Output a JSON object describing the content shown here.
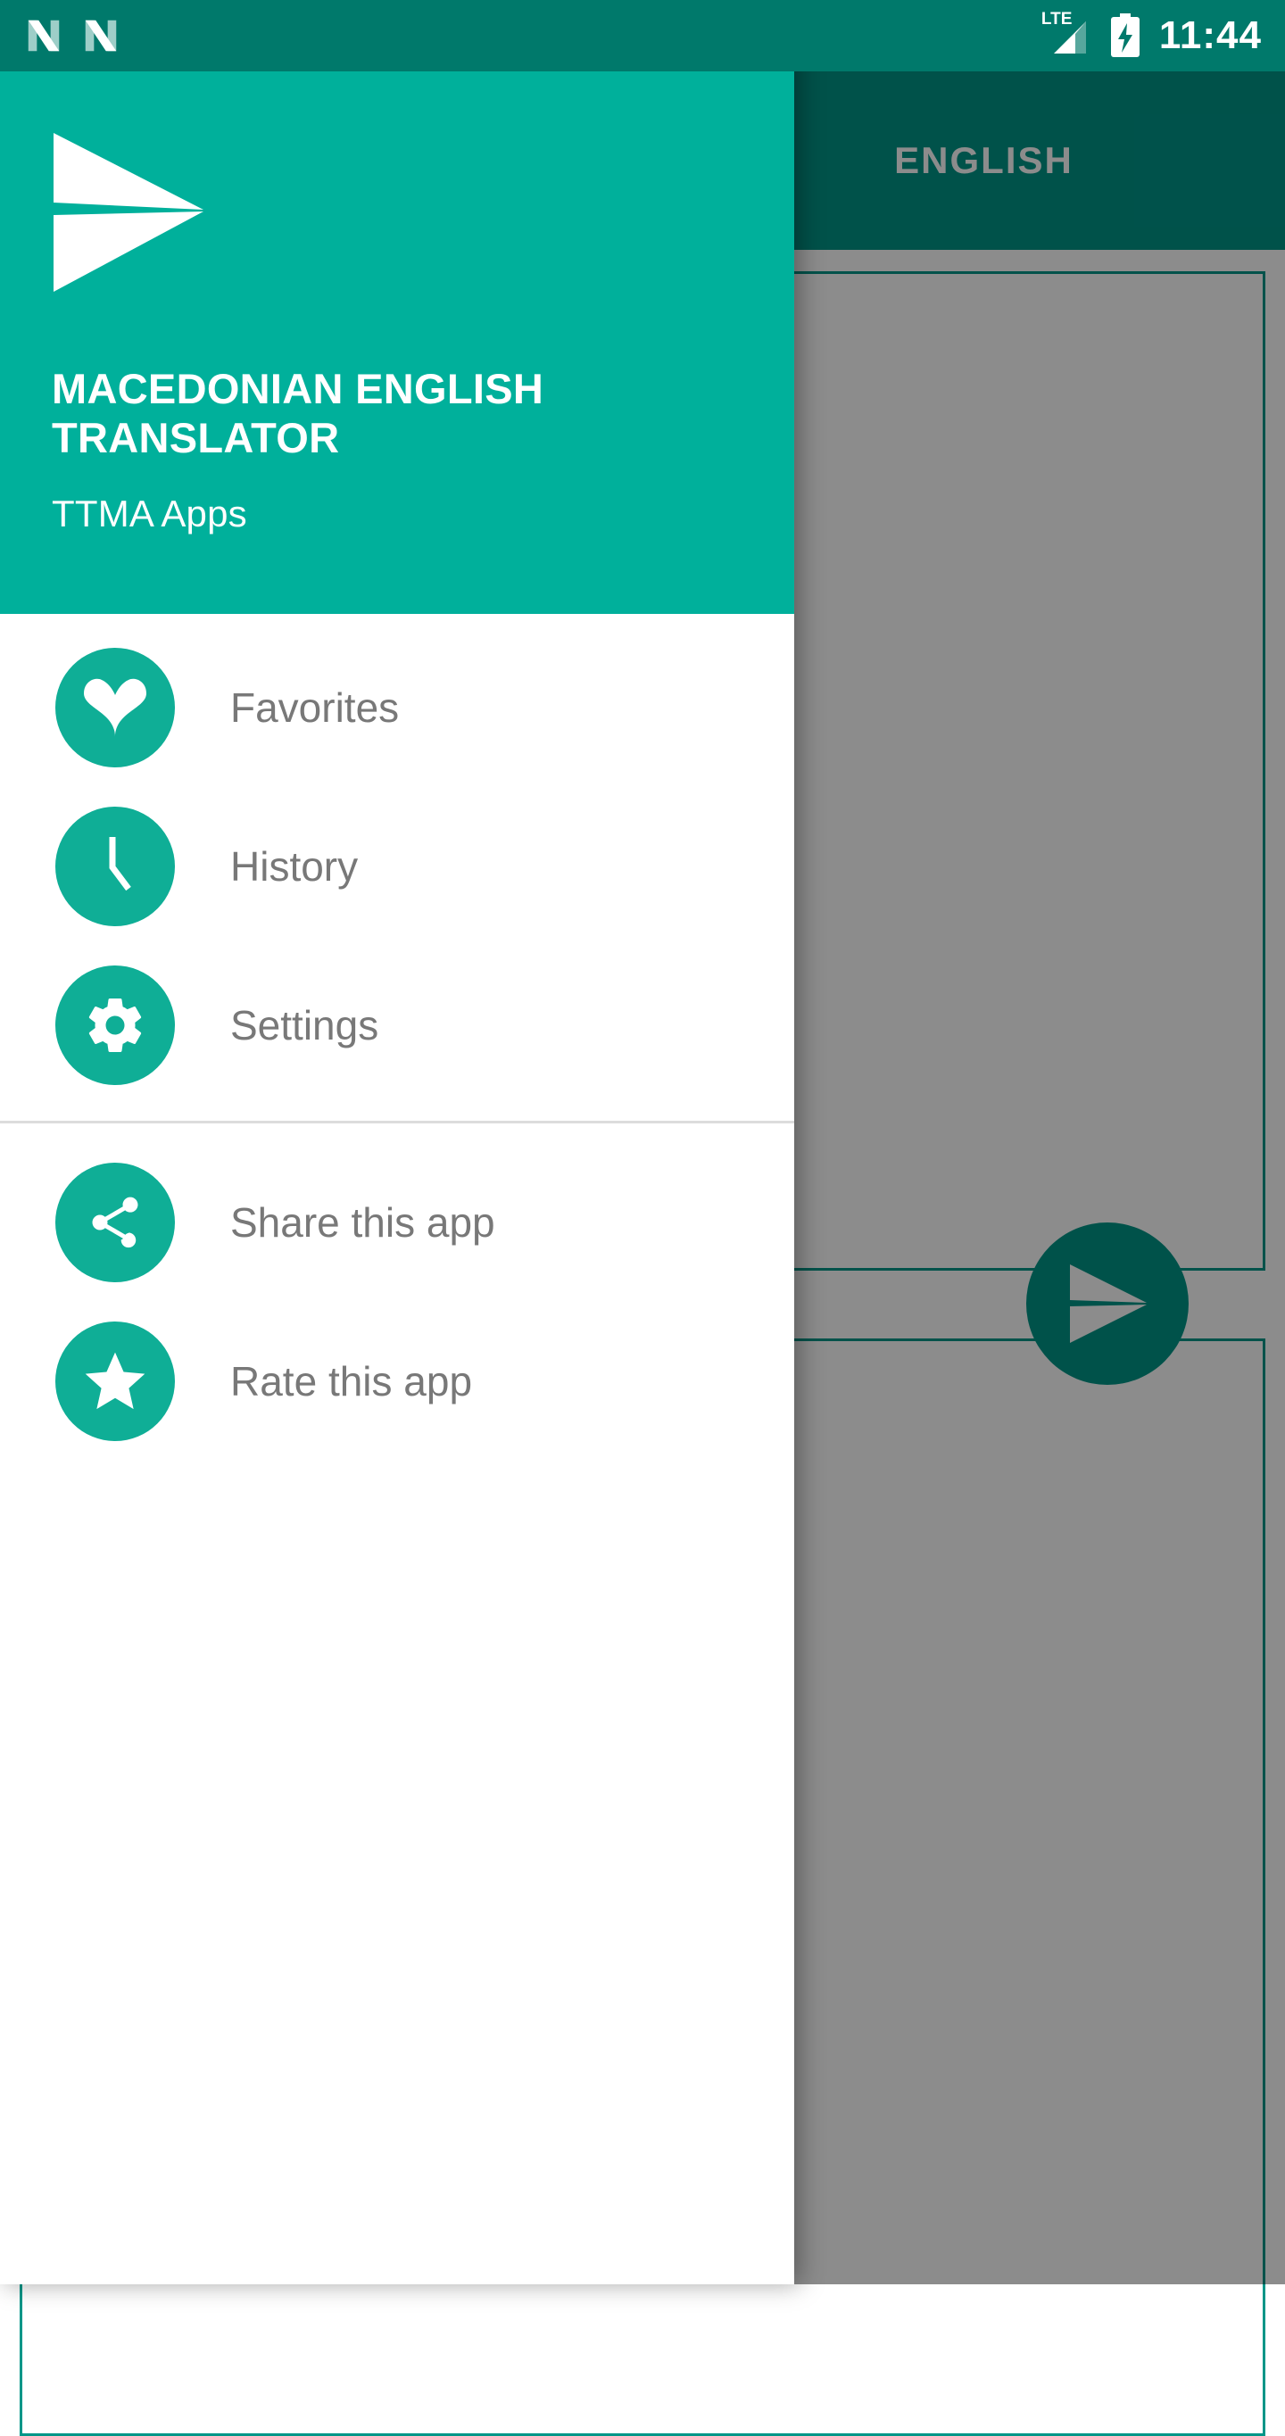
{
  "status_bar": {
    "notification_icons": [
      "android-nougat-icon",
      "android-nougat-icon"
    ],
    "network_label": "LTE",
    "signal_icon": "signal-bars-icon",
    "battery_icon": "battery-charging-icon",
    "clock": "11:44",
    "background_color": "#00796B"
  },
  "app": {
    "toolbar": {
      "source_caret_icon": "chevron-down-icon",
      "target_language_tab": "ENGLISH",
      "background_color": "#009688"
    },
    "source_box": {
      "name": "source-text-area",
      "value": "",
      "placeholder": ""
    },
    "target_box": {
      "name": "target-text-area",
      "value": "",
      "placeholder": ""
    },
    "send_button": {
      "icon": "send-icon",
      "color": "#009688"
    }
  },
  "drawer": {
    "logo_icon": "send-plane-logo",
    "title": "MACEDONIAN ENGLISH TRANSLATOR",
    "subtitle": "TTMA Apps",
    "header_color": "#00B09B",
    "icon_color": "#0FAE96",
    "label_color": "#787878",
    "primary_items": [
      {
        "label": "Favorites",
        "icon": "heart-icon"
      },
      {
        "label": "History",
        "icon": "clock-icon"
      },
      {
        "label": "Settings",
        "icon": "gear-icon"
      }
    ],
    "secondary_items": [
      {
        "label": "Share this app",
        "icon": "share-icon"
      },
      {
        "label": "Rate this app",
        "icon": "star-icon"
      }
    ]
  }
}
